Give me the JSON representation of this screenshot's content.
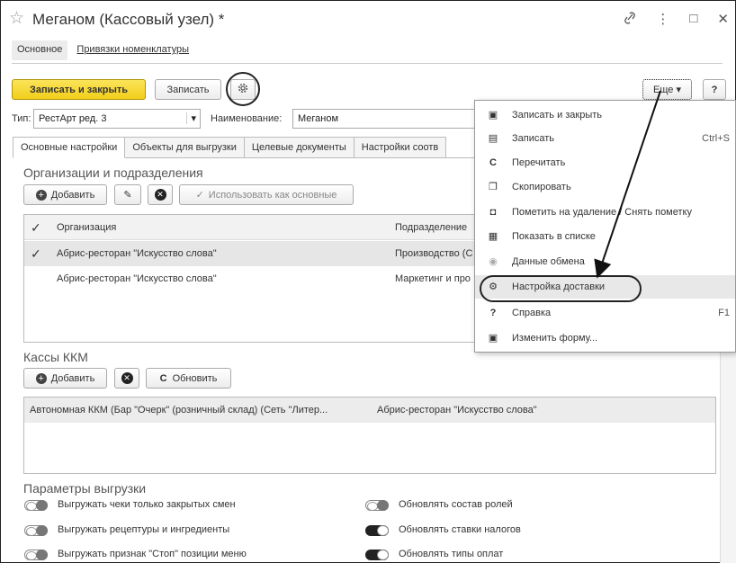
{
  "window": {
    "title": "Меганом (Кассовый узел) *",
    "link_icon": "link-icon",
    "menu_icon": "more-icon",
    "max_icon": "maximize-icon",
    "close_icon": "close-icon"
  },
  "form_tabs": [
    {
      "label": "Основное"
    },
    {
      "label": "Привязки номенклатуры"
    }
  ],
  "toolbar": {
    "save_close": "Записать и закрыть",
    "save": "Записать",
    "more": "Еще",
    "help": "?"
  },
  "type_row": {
    "type_label": "Тип:",
    "type_value": "РестАрт ред. 3",
    "name_label": "Наименование:",
    "name_value": "Меганом"
  },
  "tabs": [
    {
      "label": "Основные настройки"
    },
    {
      "label": "Объекты для выгрузки"
    },
    {
      "label": "Целевые документы"
    },
    {
      "label": "Настройки соотв"
    }
  ],
  "orgs": {
    "title": "Организации и подразделения",
    "add": "Добавить",
    "use_main": "Использовать как основные",
    "columns": [
      "Организация",
      "Подразделение"
    ],
    "rows": [
      {
        "org": "Абрис-ресторан \"Искусство слова\"",
        "dept": "Производство (С",
        "checked": true
      },
      {
        "org": "Абрис-ресторан \"Искусство слова\"",
        "dept": "Маркетинг и про",
        "checked": false
      }
    ]
  },
  "kkm": {
    "title": "Кассы ККМ",
    "add": "Добавить",
    "refresh": "Обновить",
    "rows": [
      {
        "name": "Автономная ККМ (Бар \"Очерк\" (розничный склад) (Сеть \"Литер...",
        "org": "Абрис-ресторан \"Искусство слова\""
      }
    ]
  },
  "params": {
    "title": "Параметры выгрузки",
    "left": [
      {
        "label": "Выгружать чеки только закрытых смен",
        "on": false
      },
      {
        "label": "Выгружать рецептуры и ингредиенты",
        "on": false
      },
      {
        "label": "Выгружать признак \"Стоп\" позиции меню",
        "on": false
      }
    ],
    "right": [
      {
        "label": "Обновлять состав ролей",
        "on": false
      },
      {
        "label": "Обновлять ставки налогов",
        "on": true
      },
      {
        "label": "Обновлять типы оплат",
        "on": true
      }
    ]
  },
  "menu": {
    "items": [
      {
        "label": "Записать и закрыть",
        "icon": "save-close-icon",
        "shortcut": ""
      },
      {
        "label": "Записать",
        "icon": "save-icon",
        "shortcut": "Ctrl+S"
      },
      {
        "label": "Перечитать",
        "icon": "reread-icon",
        "shortcut": ""
      },
      {
        "label": "Скопировать",
        "icon": "copy-icon",
        "shortcut": ""
      },
      {
        "label": "Пометить на удаление / Снять пометку",
        "icon": "mark-delete-icon",
        "shortcut": ""
      },
      {
        "label": "Показать в списке",
        "icon": "show-in-list-icon",
        "shortcut": ""
      },
      {
        "label": "Данные обмена",
        "icon": "exchange-data-icon",
        "shortcut": ""
      },
      {
        "label": "Настройка доставки",
        "icon": "gear-icon",
        "shortcut": ""
      },
      {
        "label": "Справка",
        "icon": "help-icon",
        "shortcut": "F1"
      },
      {
        "label": "Изменить форму...",
        "icon": "edit-form-icon",
        "shortcut": ""
      }
    ]
  },
  "colors": {
    "accent_yellow": "#f2cf1a",
    "highlight": "#e6e6e6"
  }
}
